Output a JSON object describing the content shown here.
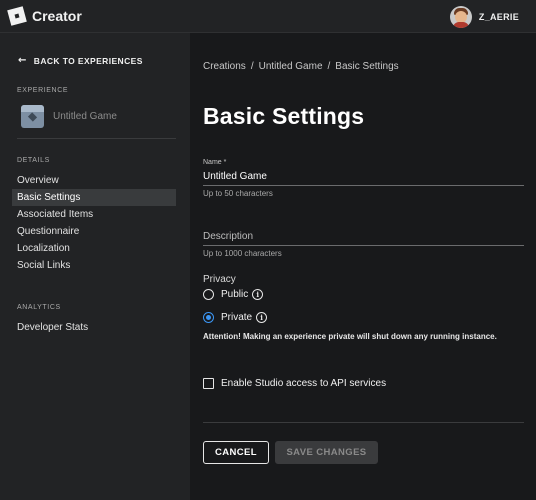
{
  "header": {
    "brand": "Creator",
    "username": "Z_AERIE"
  },
  "sidebar": {
    "back_label": "BACK TO EXPERIENCES",
    "experience_section": "EXPERIENCE",
    "experience_name": "Untitled Game",
    "details_section": "DETAILS",
    "details_items": [
      {
        "label": "Overview"
      },
      {
        "label": "Basic Settings"
      },
      {
        "label": "Associated Items"
      },
      {
        "label": "Questionnaire"
      },
      {
        "label": "Localization"
      },
      {
        "label": "Social Links"
      }
    ],
    "active_item": "Basic Settings",
    "analytics_section": "ANALYTICS",
    "analytics_items": [
      {
        "label": "Developer Stats"
      }
    ]
  },
  "main": {
    "breadcrumb": [
      "Creations",
      "/",
      "Untitled Game",
      "/",
      "Basic Settings"
    ],
    "title": "Basic Settings",
    "name_field": {
      "label": "Name *",
      "value": "Untitled Game",
      "helper": "Up to 50 characters"
    },
    "description_field": {
      "placeholder": "Description",
      "value": "",
      "helper": "Up to 1000 characters"
    },
    "privacy": {
      "label": "Privacy",
      "options": [
        {
          "label": "Public",
          "selected": false
        },
        {
          "label": "Private",
          "selected": true
        }
      ],
      "warning": "Attention! Making an experience private will shut down any running instance."
    },
    "studio_access": {
      "label": "Enable Studio access to API services",
      "checked": false
    },
    "buttons": {
      "cancel": "CANCEL",
      "save": "SAVE CHANGES"
    }
  },
  "colors": {
    "accent_radio": "#3b96f5",
    "sidebar_bg": "#222325",
    "page_bg": "#18191b"
  }
}
